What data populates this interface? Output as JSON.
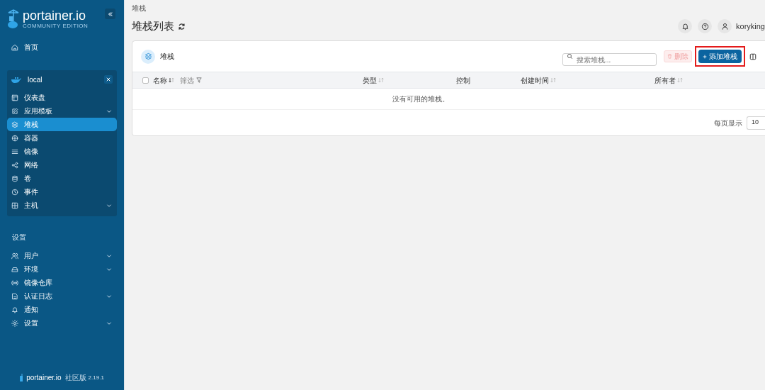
{
  "sidebar": {
    "logo": {
      "name": "portainer.io",
      "edition": "COMMUNITY EDITION"
    },
    "home": {
      "label": "首页"
    },
    "environment": {
      "name": "local",
      "items": [
        {
          "label": "仪表盘",
          "expandable": false,
          "selected": false
        },
        {
          "label": "应用模板",
          "expandable": true,
          "selected": false
        },
        {
          "label": "堆栈",
          "expandable": false,
          "selected": true
        },
        {
          "label": "容器",
          "expandable": false,
          "selected": false
        },
        {
          "label": "镜像",
          "expandable": false,
          "selected": false
        },
        {
          "label": "网络",
          "expandable": false,
          "selected": false
        },
        {
          "label": "卷",
          "expandable": false,
          "selected": false
        },
        {
          "label": "事件",
          "expandable": false,
          "selected": false
        },
        {
          "label": "主机",
          "expandable": true,
          "selected": false
        }
      ]
    },
    "settings": {
      "title": "设置",
      "items": [
        {
          "label": "用户",
          "expandable": true
        },
        {
          "label": "环境",
          "expandable": true
        },
        {
          "label": "镜像仓库",
          "expandable": false
        },
        {
          "label": "认证日志",
          "expandable": true
        },
        {
          "label": "通知",
          "expandable": false
        },
        {
          "label": "设置",
          "expandable": true
        }
      ]
    },
    "footer": {
      "brand": "portainer.io",
      "edition": "社区版",
      "version": "2.19.1"
    }
  },
  "header": {
    "breadcrumb": "堆栈",
    "title": "堆栈列表",
    "user": "koryking"
  },
  "card": {
    "title": "堆栈",
    "search": {
      "placeholder": "搜索堆栈..."
    },
    "delete_button": {
      "label": "删除",
      "disabled": true
    },
    "add_button": {
      "label": "添加堆栈",
      "highlighted": true
    },
    "select_all": {
      "checked": false
    },
    "columns": [
      {
        "label": "名称",
        "sortable": true,
        "sorted": true,
        "filter": "筛选"
      },
      {
        "label": "类型",
        "sortable": true,
        "sorted": false
      },
      {
        "label": "控制",
        "sortable": false
      },
      {
        "label": "创建时间",
        "sortable": true,
        "sorted": false
      },
      {
        "label": "所有者",
        "sortable": true,
        "sorted": false
      }
    ],
    "empty_message": "没有可用的堆栈。",
    "page_size": {
      "label": "每页显示",
      "value": "10"
    }
  }
}
